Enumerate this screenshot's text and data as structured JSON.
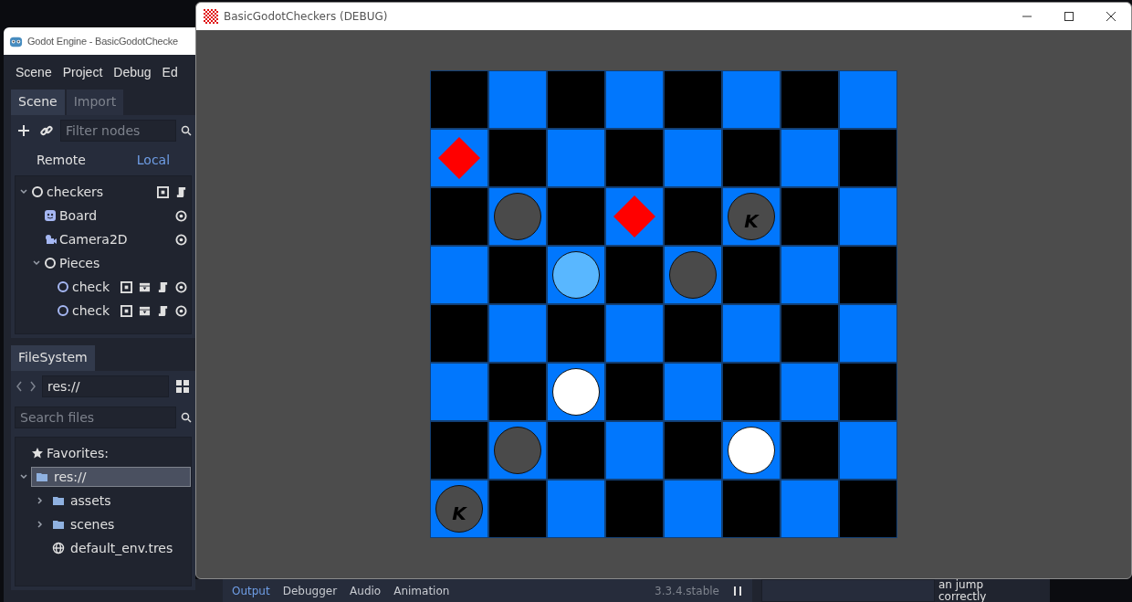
{
  "editor_window": {
    "title": "Godot Engine - BasicGodotChecke",
    "menu": [
      "Scene",
      "Project",
      "Debug",
      "Ed"
    ],
    "scene_dock": {
      "tabs": [
        {
          "label": "Scene",
          "selected": true
        },
        {
          "label": "Import",
          "selected": false
        }
      ],
      "filter": {
        "placeholder": "Filter nodes"
      },
      "modes": [
        {
          "label": "Remote",
          "selected": false
        },
        {
          "label": "Local",
          "selected": true
        }
      ],
      "tree": [
        {
          "label": "checkers",
          "kind": "node2d",
          "expanded": true,
          "indicators": [
            {
              "kind": "group"
            },
            {
              "kind": "script"
            }
          ],
          "children": [
            {
              "label": "Board",
              "kind": "tilemap",
              "indicators": [
                {
                  "kind": "visible"
                }
              ]
            },
            {
              "label": "Camera2D",
              "kind": "camera",
              "indicators": [
                {
                  "kind": "visible"
                }
              ]
            },
            {
              "label": "Pieces",
              "kind": "node2d",
              "expanded": true,
              "children": [
                {
                  "label": "check",
                  "kind": "piece",
                  "indicators": [
                    {
                      "kind": "group"
                    },
                    {
                      "kind": "scene"
                    },
                    {
                      "kind": "script"
                    },
                    {
                      "kind": "visible"
                    }
                  ]
                },
                {
                  "label": "check",
                  "kind": "piece",
                  "indicators": [
                    {
                      "kind": "group"
                    },
                    {
                      "kind": "scene"
                    },
                    {
                      "kind": "script"
                    },
                    {
                      "kind": "visible"
                    }
                  ]
                }
              ]
            }
          ]
        }
      ]
    },
    "filesystem": {
      "tab": "FileSystem",
      "path": "res://",
      "search": {
        "placeholder": "Search files"
      },
      "favorites": "Favorites:",
      "tree": [
        {
          "label": "res://",
          "kind": "folder",
          "selected": true,
          "expanded": true,
          "children": [
            {
              "label": "assets",
              "kind": "folder",
              "selected": false,
              "expanded": false
            },
            {
              "label": "scenes",
              "kind": "folder",
              "selected": false,
              "expanded": false
            },
            {
              "label": "default_env.tres",
              "kind": "resource",
              "selected": false
            }
          ]
        }
      ]
    },
    "bottom_tabs": [
      {
        "label": "Output",
        "selected": true
      },
      {
        "label": "Debugger",
        "selected": false
      },
      {
        "label": "Audio",
        "selected": false
      },
      {
        "label": "Animation",
        "selected": false
      }
    ],
    "version": "3.3.4.stable",
    "script_lines": [
      "an jump",
      "correctly"
    ]
  },
  "game_window": {
    "title": "BasicGodotCheckers (DEBUG)",
    "board": [
      {
        "cells": [
          {
            "kind": "empty"
          },
          {
            "kind": "empty"
          },
          {
            "kind": "empty"
          },
          {
            "kind": "empty"
          },
          {
            "kind": "empty"
          },
          {
            "kind": "empty"
          },
          {
            "kind": "empty"
          },
          {
            "kind": "empty"
          }
        ]
      },
      {
        "cells": [
          {
            "kind": "marker"
          },
          {
            "kind": "empty"
          },
          {
            "kind": "empty"
          },
          {
            "kind": "empty"
          },
          {
            "kind": "empty"
          },
          {
            "kind": "empty"
          },
          {
            "kind": "empty"
          },
          {
            "kind": "empty"
          }
        ]
      },
      {
        "cells": [
          {
            "kind": "empty"
          },
          {
            "kind": "dark",
            "selected": false
          },
          {
            "kind": "empty"
          },
          {
            "kind": "marker"
          },
          {
            "kind": "empty"
          },
          {
            "kind": "dark",
            "selected": false,
            "king_label": "K"
          },
          {
            "kind": "empty"
          },
          {
            "kind": "empty"
          }
        ]
      },
      {
        "cells": [
          {
            "kind": "empty"
          },
          {
            "kind": "empty"
          },
          {
            "kind": "light",
            "selected": true
          },
          {
            "kind": "empty"
          },
          {
            "kind": "dark",
            "selected": false
          },
          {
            "kind": "empty"
          },
          {
            "kind": "empty"
          },
          {
            "kind": "empty"
          }
        ]
      },
      {
        "cells": [
          {
            "kind": "empty"
          },
          {
            "kind": "empty"
          },
          {
            "kind": "empty"
          },
          {
            "kind": "empty"
          },
          {
            "kind": "empty"
          },
          {
            "kind": "empty"
          },
          {
            "kind": "empty"
          },
          {
            "kind": "empty"
          }
        ]
      },
      {
        "cells": [
          {
            "kind": "empty"
          },
          {
            "kind": "empty"
          },
          {
            "kind": "light",
            "selected": false
          },
          {
            "kind": "empty"
          },
          {
            "kind": "empty"
          },
          {
            "kind": "empty"
          },
          {
            "kind": "empty"
          },
          {
            "kind": "empty"
          }
        ]
      },
      {
        "cells": [
          {
            "kind": "empty"
          },
          {
            "kind": "dark",
            "selected": false
          },
          {
            "kind": "empty"
          },
          {
            "kind": "empty"
          },
          {
            "kind": "empty"
          },
          {
            "kind": "light",
            "selected": false
          },
          {
            "kind": "empty"
          },
          {
            "kind": "empty"
          }
        ]
      },
      {
        "cells": [
          {
            "kind": "dark",
            "selected": false,
            "king_label": "K"
          },
          {
            "kind": "empty"
          },
          {
            "kind": "empty"
          },
          {
            "kind": "empty"
          },
          {
            "kind": "empty"
          },
          {
            "kind": "empty"
          },
          {
            "kind": "empty"
          },
          {
            "kind": "empty"
          }
        ]
      }
    ]
  }
}
